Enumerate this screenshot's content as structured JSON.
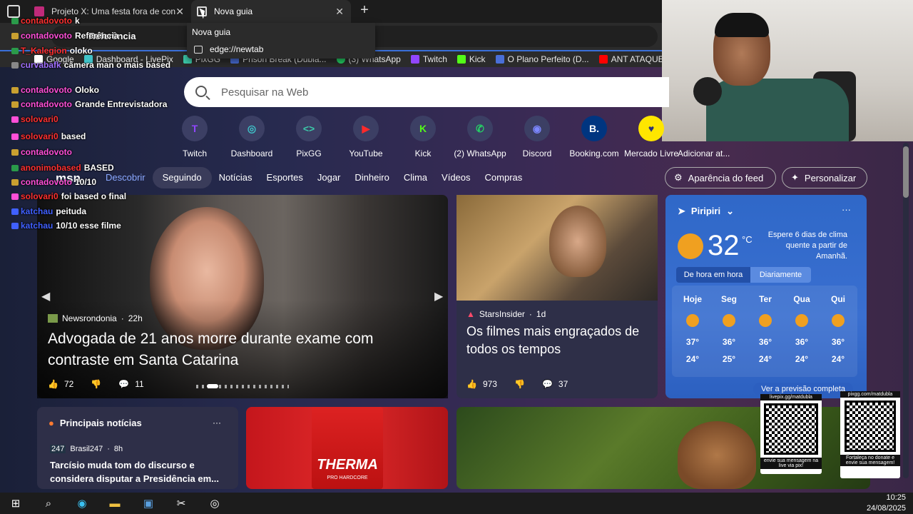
{
  "browser": {
    "tabs": [
      {
        "label": "Projeto X: Uma festa fora de con",
        "active": false
      },
      {
        "label": "Nova guia",
        "active": true
      }
    ],
    "new_tab_label": "+",
    "tooltip": {
      "title": "Nova guia",
      "url": "edge://newtab"
    },
    "address_text": "Referência",
    "favorites": [
      "Google",
      "Dashboard - LivePix",
      "PixGG",
      "Prison Break (Dubla...",
      "(3) WhatsApp",
      "Twitch",
      "Kick",
      "O Plano Perfeito (D...",
      "ANT ATAQUE"
    ]
  },
  "search": {
    "placeholder": "Pesquisar na Web"
  },
  "quick_links": [
    {
      "label": "Twitch",
      "color": "#9146ff",
      "glyph": "T"
    },
    {
      "label": "Dashboard",
      "color": "#3fc3c9",
      "glyph": "◎"
    },
    {
      "label": "PixGG",
      "color": "#3cc9a9",
      "glyph": "<>"
    },
    {
      "label": "YouTube",
      "color": "#ff0000",
      "glyph": "▶"
    },
    {
      "label": "Kick",
      "color": "#53fc18",
      "glyph": "K"
    },
    {
      "label": "(2) WhatsApp",
      "color": "#25d366",
      "glyph": "✆"
    },
    {
      "label": "Discord",
      "color": "#5865f2",
      "glyph": "◉"
    },
    {
      "label": "Booking.com",
      "color": "#003580",
      "glyph": "B."
    },
    {
      "label": "Mercado Livre",
      "color": "#ffe600",
      "glyph": "♥"
    },
    {
      "label": "Adicionar at...",
      "color": "#3c3f64",
      "glyph": ""
    }
  ],
  "msn": {
    "logo": "msn",
    "nav": [
      "Descobrir",
      "Seguindo",
      "Notícias",
      "Esportes",
      "Jogar",
      "Dinheiro",
      "Clima",
      "Vídeos",
      "Compras"
    ],
    "feed_appearance": "Aparência do feed",
    "personalize": "Personalizar"
  },
  "hero": {
    "source": "Newsrondonia",
    "age": "22h",
    "headline": "Advogada de 21 anos morre durante exame com contraste em Santa Catarina",
    "likes": "72",
    "comments": "11"
  },
  "card2": {
    "source": "StarsInsider",
    "age": "1d",
    "headline": "Os filmes mais engraçados de todos os tempos",
    "likes": "973",
    "comments": "37"
  },
  "weather": {
    "city": "Piripiri",
    "temp": "32",
    "unit": "°C",
    "alert": "Espere 6 dias de clima quente a partir de Amanhã.",
    "tab_hourly": "De hora em hora",
    "tab_daily": "Diariamente",
    "days": [
      {
        "name": "Hoje",
        "high": "37°",
        "low": "24°"
      },
      {
        "name": "Seg",
        "high": "36°",
        "low": "25°"
      },
      {
        "name": "Ter",
        "high": "36°",
        "low": "24°"
      },
      {
        "name": "Qua",
        "high": "36°",
        "low": "24°"
      },
      {
        "name": "Qui",
        "high": "36°",
        "low": "24°"
      }
    ],
    "full_forecast": "Ver a previsão completa"
  },
  "bottom": {
    "top_news_title": "Principais notícias",
    "top_news_source": "Brasil247",
    "top_news_age": "8h",
    "top_news_headline": "Tarcísio muda tom do discurso e considera disputar a Presidência em...",
    "ad_label": "THERMA",
    "ad_sub": "PRO HARDCORE"
  },
  "chat": [
    {
      "user": "contadovoto",
      "msg": "k",
      "color": "#ff4fd8"
    },
    {
      "user": "contadovoto",
      "msg": "Referência",
      "color": "#ff4fd8"
    },
    {
      "user": "T_Kalegion",
      "msg": "oloko",
      "color": "#ff3030"
    },
    {
      "user": "curvabafk",
      "msg": "câmera man o mais based",
      "color": "#a070ff"
    },
    {
      "user": "contadovoto",
      "msg": "Oloko",
      "color": "#ff4fd8"
    },
    {
      "user": "contadovoto",
      "msg": "Grande Entrevistadora",
      "color": "#ff4fd8"
    },
    {
      "user": "solovari0",
      "msg": "",
      "color": "#ff3030"
    },
    {
      "user": "solovari0",
      "msg": "based",
      "color": "#ff3030"
    },
    {
      "user": "contadovoto",
      "msg": "",
      "color": "#ff4fd8"
    },
    {
      "user": "anonimobased",
      "msg": "BASED",
      "color": "#ff3030"
    },
    {
      "user": "contadovoto",
      "msg": "10/10",
      "color": "#ff4fd8"
    },
    {
      "user": "solovari0",
      "msg": "foi based o final",
      "color": "#ff3030"
    },
    {
      "user": "katchau",
      "msg": "peituda",
      "color": "#4060ff"
    },
    {
      "user": "katchau",
      "msg": "10/10 esse filme",
      "color": "#4060ff"
    }
  ],
  "qr": {
    "left_top": "livepix.gg/matdubla",
    "left_bottom": "envie sua mensagem na live via pix!",
    "right_top": "pixgg.com/matdubla",
    "right_bottom": "Fortaleça no donate e envie sua mensagem!"
  },
  "taskbar": {
    "time": "10:25",
    "date": "24/08/2025"
  }
}
